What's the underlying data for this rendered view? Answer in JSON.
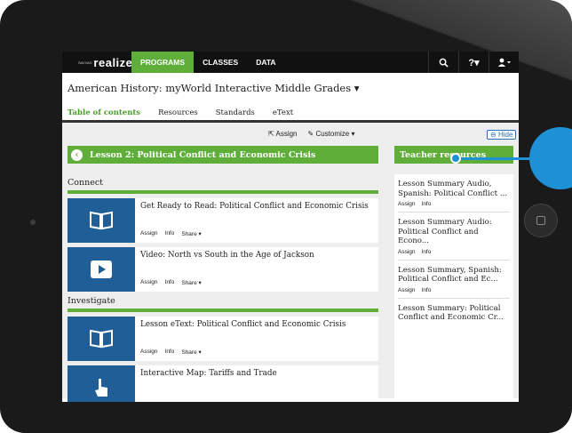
{
  "nav": {
    "logo_small": "SAVVAS",
    "logo_big": "realize.",
    "items": [
      "PROGRAMS",
      "CLASSES",
      "DATA"
    ],
    "icons": {
      "search": "search-icon",
      "help": "?▾",
      "user": "user-icon"
    }
  },
  "program": {
    "title": "American History: myWorld Interactive Middle Grades ▾",
    "tabs": [
      "Table of contents",
      "Resources",
      "Standards",
      "eText"
    ]
  },
  "toolbar": {
    "assign": "Assign",
    "customize": "Customize ▾",
    "hide": "Hide"
  },
  "lesson": {
    "title": "Lesson 2: Political Conflict and Economic Crisis"
  },
  "sections": [
    {
      "name": "Connect"
    },
    {
      "name": "Investigate"
    }
  ],
  "cards": [
    {
      "title": "Get Ready to Read: Political Conflict and Economic Crisis",
      "icon": "book-icon"
    },
    {
      "title": "Video: North vs South in the Age of Jackson",
      "icon": "play-icon"
    },
    {
      "title": "Lesson eText: Political Conflict and Economic Crisis",
      "icon": "book-icon"
    },
    {
      "title": "Interactive Map: Tariffs and Trade",
      "icon": "hand-pointer-icon"
    }
  ],
  "card_actions": {
    "assign": "Assign",
    "info": "Info",
    "share": "Share ▾"
  },
  "teacher_resources": {
    "header": "Teacher resources",
    "items": [
      {
        "title": "Lesson Summary Audio, Spanish: Political Conflict ..."
      },
      {
        "title": "Lesson Summary Audio: Political Conflict and Econo..."
      },
      {
        "title": "Lesson Summary, Spanish: Political Conflict and Ec..."
      },
      {
        "title": "Lesson Summary: Political Conflict and Economic Cr..."
      }
    ],
    "assign": "Assign",
    "info": "Info"
  },
  "colors": {
    "accent": "#5fae3a",
    "thumb": "#1f5e96",
    "callout": "#1e90d6"
  }
}
